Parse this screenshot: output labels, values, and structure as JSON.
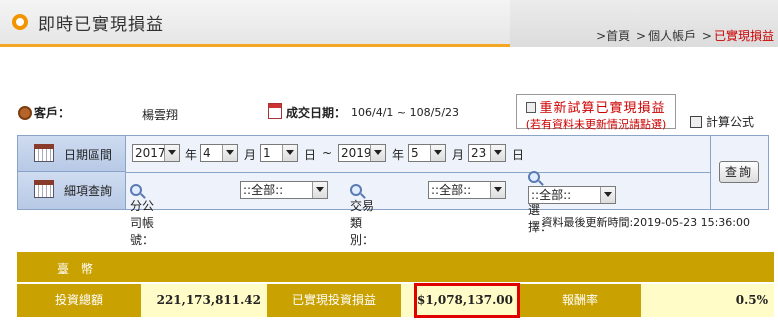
{
  "header": {
    "title": "即時已實現損益",
    "breadcrumb": [
      {
        "label": "首頁"
      },
      {
        "label": "個人帳戶"
      },
      {
        "label": "已實現損益"
      }
    ],
    "separator": ">",
    "colors": {
      "accent": "#f29400",
      "current_crumb": "#cc0000"
    }
  },
  "info": {
    "customer_label": "客戶：",
    "customer_value": "楊雲翔",
    "trade_date_label": "成交日期：",
    "trade_date_value": "106/4/1 ~ 108/5/23",
    "recalc_label": "重新試算已實現損益",
    "recalc_note": "(若有資料未更新情況請點選)",
    "formula_label": "計算公式"
  },
  "query": {
    "date_range_label": "日期區間",
    "detail_label": "細項查詢",
    "from": {
      "year": "2017",
      "month": "4",
      "day": "1"
    },
    "to": {
      "year": "2019",
      "month": "5",
      "day": "23"
    },
    "unit_year": "年",
    "unit_month": "月",
    "unit_day": "日",
    "range_sep": "~",
    "branch_label": "分公司帳號：",
    "branch_value": "::全部::",
    "trade_type_label": "交易類別：",
    "trade_type_value": "::全部::",
    "stock_label": "股票選擇：",
    "stock_value": "::全部::",
    "query_button": "查詢",
    "updated_text": "資料最後更新時間:2019-05-23 15:36:00"
  },
  "summary": {
    "currency": "臺 幣",
    "invest_total_label": "投資總額",
    "invest_total_value": "221,173,811.42",
    "realized_label": "已實現投資損益",
    "realized_value": "$1,078,137.00",
    "return_label": "報酬率",
    "return_value": "0.5%",
    "colors": {
      "header": "#c9a100",
      "value_bg": "#fffcc8",
      "highlight": "#e00000"
    }
  }
}
